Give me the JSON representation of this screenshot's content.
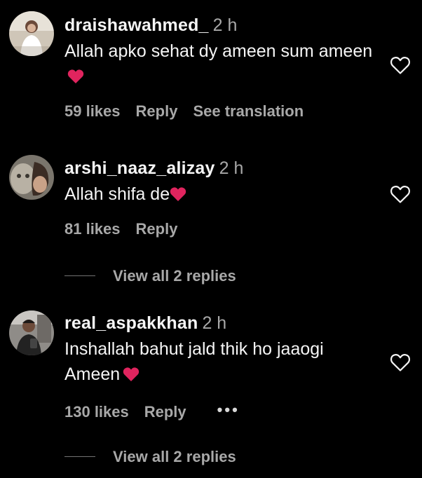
{
  "comments": [
    {
      "username": "draishawahmed_",
      "time": "2 h",
      "text": "Allah apko sehat dy ameen sum ameen",
      "likes": "59 likes",
      "reply_label": "Reply",
      "translate_label": "See translation",
      "emoji": "red-heart"
    },
    {
      "username": "arshi_naaz_alizay",
      "time": "2 h",
      "text": "Allah shifa de",
      "likes": "81 likes",
      "reply_label": "Reply",
      "view_replies": "View all 2 replies",
      "emoji": "red-heart"
    },
    {
      "username": "real_aspakkhan",
      "time": "2 h",
      "text": "Inshallah bahut jald thik ho jaaogi Ameen",
      "likes": "130 likes",
      "reply_label": "Reply",
      "more_label": "•••",
      "view_replies": "View all 2 replies",
      "emoji": "red-heart"
    }
  ],
  "colors": {
    "background": "#000000",
    "primary_text": "#f5f5f5",
    "secondary_text": "#a8a8a8",
    "heart_emoji": "#e0245e"
  },
  "icons": {
    "like": "heart-outline-icon",
    "emoji": "red-heart-emoji"
  }
}
